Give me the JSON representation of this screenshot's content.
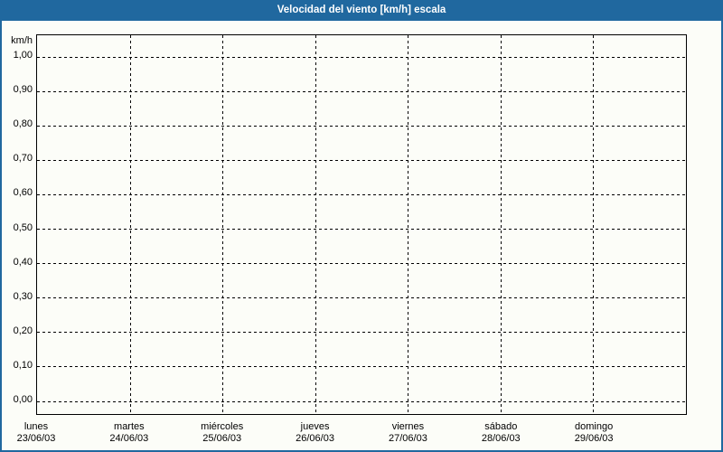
{
  "title_bar": {
    "title": "Velocidad del viento [km/h] escala"
  },
  "colors": {
    "frame_blue": "#20689F",
    "background": "#FCFDF8",
    "title_text": "#FFFFFF",
    "grid_line": "#000000",
    "plot_border": "#000000",
    "label_text": "#000000"
  },
  "chart_data": {
    "type": "line",
    "title": "Velocidad del viento [km/h] escala",
    "ylabel": "km/h",
    "grid": "dashed",
    "legend": "none",
    "y_axis": {
      "unit_label": "km/h",
      "min": 0.0,
      "max": 1.0,
      "tick_step": 0.1,
      "tick_labels": [
        "1,00",
        "0,90",
        "0,80",
        "0,70",
        "0,60",
        "0,50",
        "0,40",
        "0,30",
        "0,20",
        "0,10",
        "0,00"
      ]
    },
    "x_axis": {
      "categories": [
        {
          "day": "lunes",
          "date": "23/06/03"
        },
        {
          "day": "martes",
          "date": "24/06/03"
        },
        {
          "day": "miércoles",
          "date": "25/06/03"
        },
        {
          "day": "jueves",
          "date": "26/06/03"
        },
        {
          "day": "viernes",
          "date": "27/06/03"
        },
        {
          "day": "sábado",
          "date": "28/06/03"
        },
        {
          "day": "domingo",
          "date": "29/06/03"
        }
      ]
    },
    "series": []
  }
}
